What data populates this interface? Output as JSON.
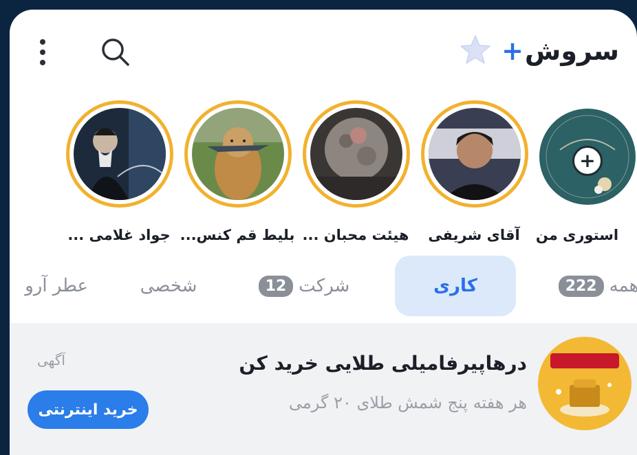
{
  "header": {
    "brand_name": "سروش",
    "brand_plus": "+",
    "icons": {
      "search": "search-icon",
      "menu": "more-vertical-icon",
      "star": "star-icon"
    }
  },
  "stories": [
    {
      "label": "استوری من",
      "type": "own",
      "icon": "add-icon"
    },
    {
      "label": "آقای  شریفی"
    },
    {
      "label": "هیئت محبان ..."
    },
    {
      "label": "بلیط قم کنس..."
    },
    {
      "label": "جواد غلامی ..."
    }
  ],
  "tabs": [
    {
      "label": "همه",
      "count": "222"
    },
    {
      "label": "کاری",
      "active": true
    },
    {
      "label": "شرکت",
      "count": "12"
    },
    {
      "label": "شخصی"
    },
    {
      "label": "عطر آرو"
    }
  ],
  "ad": {
    "title": "درهاپیرفامیلی طلایی خرید کن",
    "subtitle": "هر هفته پنج شمش طلای ۲۰ گرمی",
    "tag": "آگهی",
    "cta": "خرید اینترنتی"
  },
  "colors": {
    "accent": "#2b6fe8",
    "ring": "#f2b12e",
    "background": "#0b2440"
  }
}
